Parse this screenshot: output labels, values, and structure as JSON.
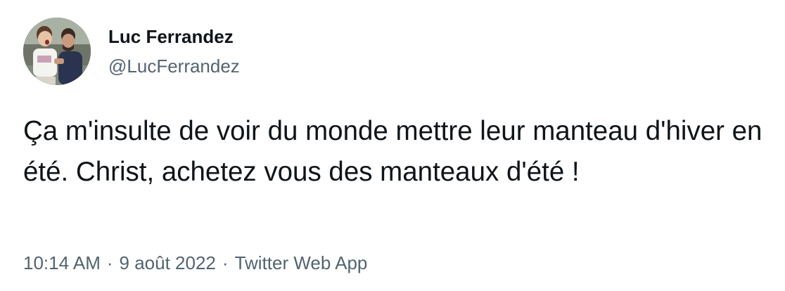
{
  "tweet": {
    "author": {
      "display_name": "Luc Ferrandez",
      "handle": "@LucFerrandez",
      "avatar_icon": "profile-photo"
    },
    "text": "Ça m'insulte de voir du monde mettre leur manteau d'hiver en été. Christ, achetez vous des manteaux d'été !",
    "time": "10:14 AM",
    "date": "9 août 2022",
    "separator": "·",
    "source": "Twitter Web App"
  },
  "colors": {
    "text_primary": "#0f1419",
    "text_secondary": "#536471",
    "background": "#ffffff"
  }
}
